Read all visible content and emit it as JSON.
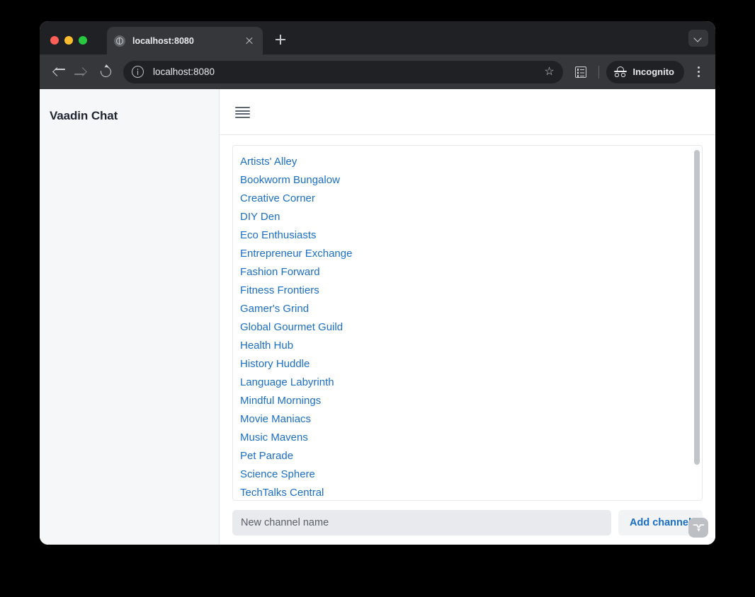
{
  "browser": {
    "tab": {
      "title": "localhost:8080",
      "favicon": "globe-icon",
      "close": "close-icon"
    },
    "new_tab_label": "+",
    "tab_search": "chevron-down-icon",
    "toolbar": {
      "back": "back-arrow-icon",
      "forward": "forward-arrow-icon",
      "reload": "reload-icon",
      "site_info": "info-icon",
      "url": "localhost:8080",
      "bookmark": "star-icon",
      "reading_list": "reading-list-icon",
      "incognito_label": "Incognito",
      "incognito_icon": "incognito-hat-icon",
      "menu": "kebab-menu-icon"
    },
    "window_controls": [
      "close",
      "minimize",
      "maximize"
    ]
  },
  "app": {
    "title": "Vaadin Chat",
    "menu_toggle": "hamburger-icon",
    "channels": [
      "Artists' Alley",
      "Bookworm Bungalow",
      "Creative Corner",
      "DIY Den",
      "Eco Enthusiasts",
      "Entrepreneur Exchange",
      "Fashion Forward",
      "Fitness Frontiers",
      "Gamer's Grind",
      "Global Gourmet Guild",
      "Health Hub",
      "History Huddle",
      "Language Labyrinth",
      "Mindful Mornings",
      "Movie Maniacs",
      "Music Mavens",
      "Pet Parade",
      "Science Sphere",
      "TechTalks Central"
    ],
    "composer": {
      "input_value": "",
      "input_placeholder": "New channel name",
      "add_button_label": "Add channel"
    },
    "branding_badge": "vaadin-logo-icon"
  },
  "colors": {
    "link": "#1a6ec4",
    "chrome_dark": "#202124",
    "chrome_toolbar": "#35373a",
    "sidebar_bg": "#f5f7f8",
    "input_bg": "#e8eaed"
  }
}
